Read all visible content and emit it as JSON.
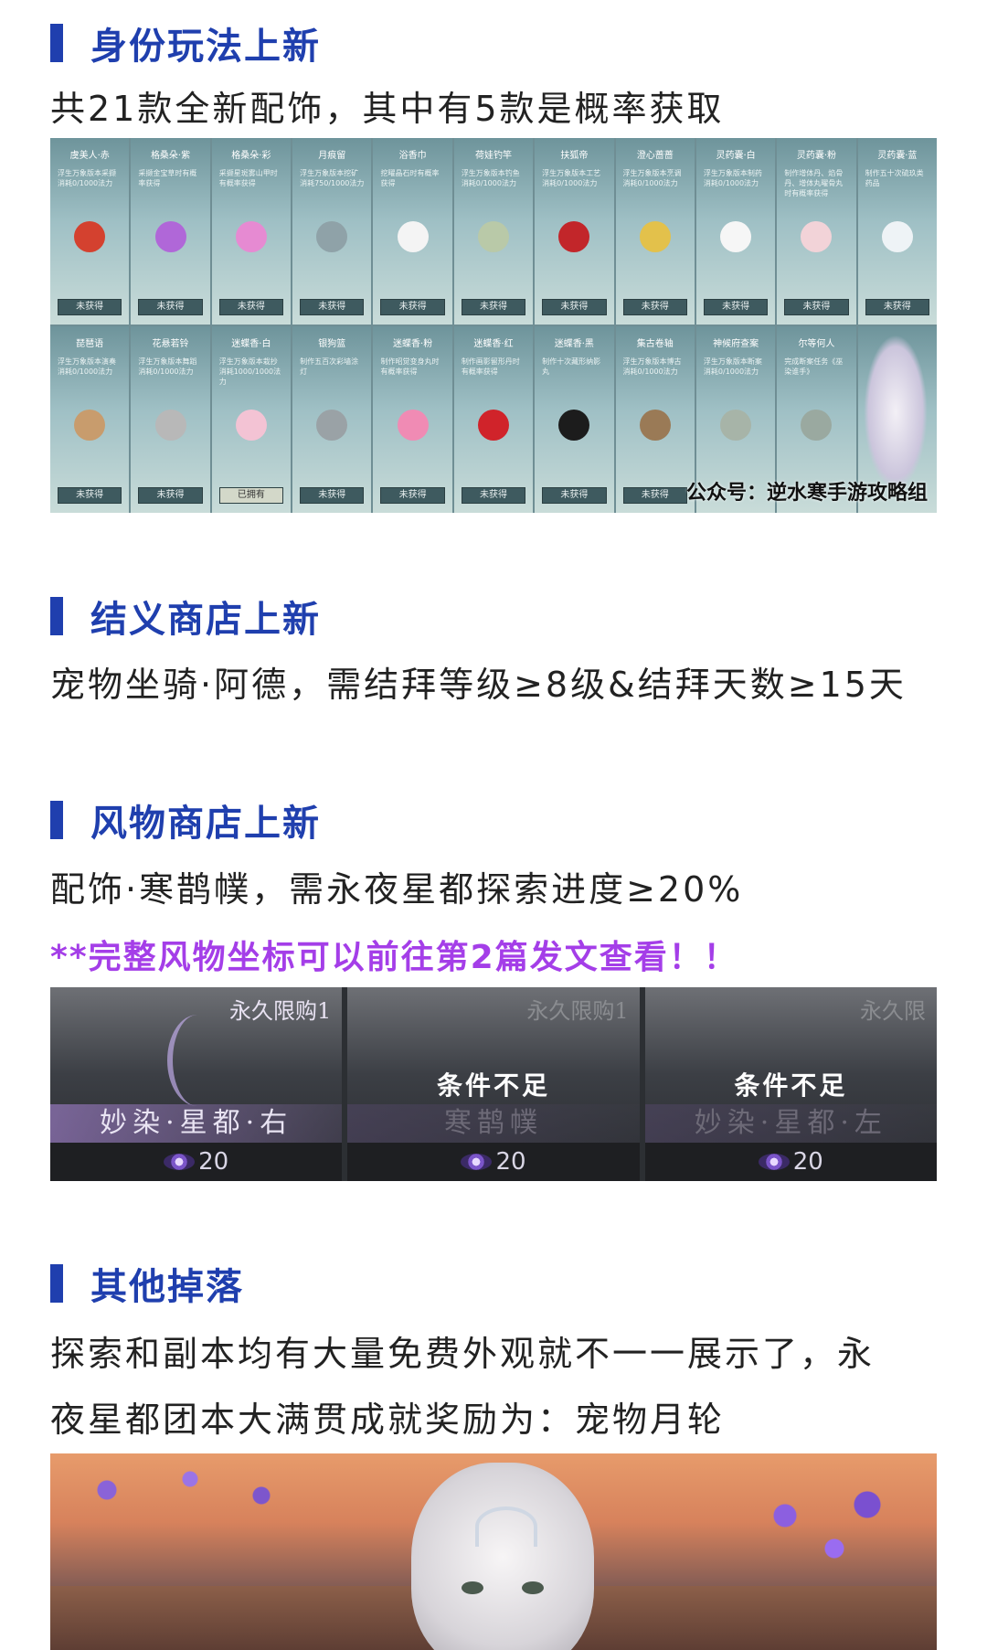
{
  "sections": [
    {
      "title": "身份玩法上新",
      "body": "共21款全新配饰，其中有5款是概率获取"
    },
    {
      "title": "结义商店上新",
      "body": "宠物坐骑·阿德，需结拜等级≥8级&结拜天数≥15天"
    },
    {
      "title": "风物商店上新",
      "body": "配饰·寒鹊幞，需永夜星都探索进度≥20%",
      "note": "**完整风物坐标可以前往第2篇发文查看！！"
    },
    {
      "title": "其他掉落",
      "body_line1": "探索和副本均有大量免费外观就不一一展示了，永",
      "body_line2": "夜星都团本大满贯成就奖励为：宠物月轮"
    }
  ],
  "accessory_grid": {
    "cards": [
      {
        "name": "虞美人·赤",
        "desc": "浮生万象版本采撷消耗0/1000法力",
        "status": "未获得",
        "color": "#d4412f"
      },
      {
        "name": "格桑朵·紫",
        "desc": "采撷金宝草时有概率获得",
        "status": "未获得",
        "color": "#b067d8"
      },
      {
        "name": "格桑朵·彩",
        "desc": "采撷星斑雾山甲时有概率获得",
        "status": "未获得",
        "color": "#e68ad2"
      },
      {
        "name": "月痕留",
        "desc": "浮生万象版本挖矿消耗750/1000法力",
        "status": "未获得",
        "color": "#8fa2a8"
      },
      {
        "name": "浴香巾",
        "desc": "挖曜晶石时有概率获得",
        "status": "未获得",
        "color": "#f4f4f4"
      },
      {
        "name": "荷娃钓竿",
        "desc": "浮生万象版本钓鱼消耗0/1000法力",
        "status": "未获得",
        "color": "#b9c9a8"
      },
      {
        "name": "扶狐帝",
        "desc": "浮生万象版本工艺消耗0/1000法力",
        "status": "未获得",
        "color": "#c2262a"
      },
      {
        "name": "澄心蔷蔷",
        "desc": "浮生万象版本烹调消耗0/1000法力",
        "status": "未获得",
        "color": "#e3c14b"
      },
      {
        "name": "灵药囊·白",
        "desc": "浮生万象版本制药消耗0/1000法力",
        "status": "未获得",
        "color": "#f6f6f6"
      },
      {
        "name": "灵药囊·粉",
        "desc": "制作增体丹、焰骨丹、增体丸曜骨丸时有概率获得",
        "status": "未获得",
        "color": "#f2d3d8"
      },
      {
        "name": "灵药囊·蓝",
        "desc": "制作五十次硫玖类药品",
        "status": "未获得",
        "color": "#eef3f6"
      },
      {
        "name": "琵琶语",
        "desc": "浮生万象版本演奏消耗0/1000法力",
        "status": "未获得",
        "color": "#c89c6d"
      },
      {
        "name": "花悬若铃",
        "desc": "浮生万象版本舞蹈消耗0/1000法力",
        "status": "未获得",
        "color": "#b8b8b8"
      },
      {
        "name": "迷蝶香·白",
        "desc": "浮生万象版本栽抄消耗1000/1000法力",
        "status": "已拥有",
        "color": "#f3c3d4"
      },
      {
        "name": "银狗篮",
        "desc": "制作五百次彩墙涂灯",
        "status": "未获得",
        "color": "#9aa2a6"
      },
      {
        "name": "迷蝶香·粉",
        "desc": "制作昭觉变身丸时有概率获得",
        "status": "未获得",
        "color": "#f08bb4"
      },
      {
        "name": "迷蝶香·红",
        "desc": "制作画影留形丹时有概率获得",
        "status": "未获得",
        "color": "#d0232a"
      },
      {
        "name": "迷蝶香·黑",
        "desc": "制作十次藏形纳影丸",
        "status": "未获得",
        "color": "#1c1c1c"
      },
      {
        "name": "集古卷轴",
        "desc": "浮生万象版本博古消耗0/1000法力",
        "status": "未获得",
        "color": "#9a7a56"
      },
      {
        "name": "神候府查案",
        "desc": "浮生万象版本断案消耗0/1000法力",
        "status": "",
        "color": "#a7b4a8"
      },
      {
        "name": "尔等何人",
        "desc": "完成断案任务《巫染谁手》",
        "status": "",
        "color": "#9aa9a0"
      }
    ],
    "watermark": "公众号：逆水寒手游攻略组"
  },
  "shop_panels": [
    {
      "limit": "永久限购1",
      "condition": "",
      "name": "妙染·星都·右",
      "price": "20"
    },
    {
      "limit": "永久限购1",
      "condition": "条件不足",
      "name": "寒鹊幞",
      "price": "20"
    },
    {
      "limit": "永久限",
      "condition": "条件不足",
      "name": "妙染·星都·左",
      "price": "20"
    }
  ]
}
